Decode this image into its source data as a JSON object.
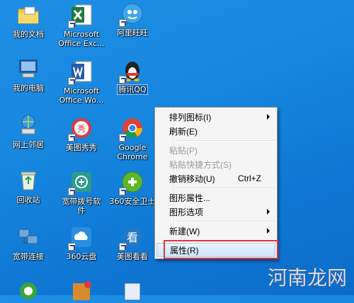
{
  "desktop": {
    "icons": [
      {
        "label": "我的文档",
        "icon": "my-documents-folder-icon"
      },
      {
        "label": "Microsoft\nOffice Exc...",
        "icon": "excel-icon"
      },
      {
        "label": "阿里旺旺",
        "icon": "aliwangwang-icon"
      },
      {
        "label": "我的电脑",
        "icon": "my-computer-icon"
      },
      {
        "label": "Microsoft\nOffice Wo...",
        "icon": "word-icon"
      },
      {
        "label": "腾讯QQ",
        "icon": "qq-penguin-icon"
      },
      {
        "label": "网上邻居",
        "icon": "network-places-icon"
      },
      {
        "label": "美图秀秀",
        "icon": "meitu-xiuxiu-icon"
      },
      {
        "label": "Google\nChrome",
        "icon": "chrome-icon"
      },
      {
        "label": "回收站",
        "icon": "recycle-bin-icon"
      },
      {
        "label": "宽带拨号软\n件",
        "icon": "broadband-dialer-icon"
      },
      {
        "label": "360安全卫士",
        "icon": "360-security-icon"
      },
      {
        "label": "宽带连接",
        "icon": "broadband-connection-icon"
      },
      {
        "label": "360云盘",
        "icon": "360-cloud-disk-icon"
      },
      {
        "label": "美图看看",
        "icon": "meitu-viewer-icon"
      }
    ]
  },
  "context_menu": {
    "items": [
      {
        "label": "排列图标(I)",
        "submenu": true
      },
      {
        "label": "刷新(E)"
      },
      {
        "label": "粘贴(P)",
        "disabled": true
      },
      {
        "label": "粘贴快捷方式(S)",
        "disabled": true
      },
      {
        "label": "撤销移动(U)",
        "shortcut": "Ctrl+Z"
      },
      {
        "label": "图形属性...",
        "submenu": false
      },
      {
        "label": "图形选项",
        "submenu": true
      },
      {
        "label": "新建(W)",
        "submenu": true
      },
      {
        "label": "属性(R)",
        "highlighted": true
      }
    ]
  },
  "watermark": {
    "text": "河南龙网"
  },
  "colors": {
    "highlight_box": "#e4343a",
    "desktop": "#1686de"
  }
}
